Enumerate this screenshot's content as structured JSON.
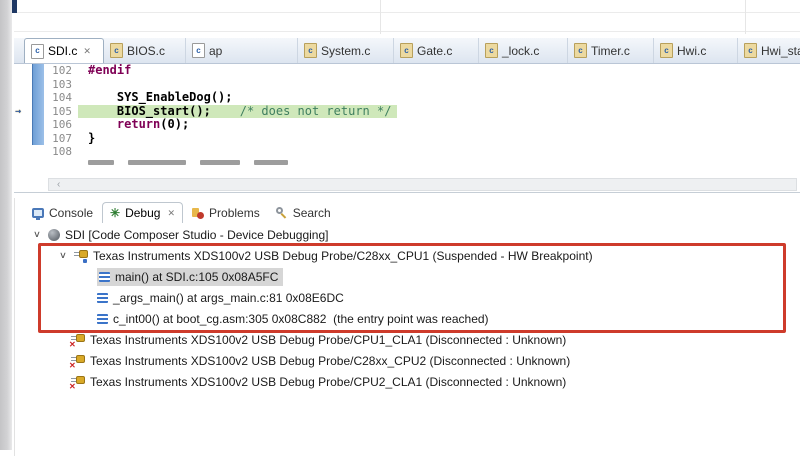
{
  "icons": {
    "close": "✕",
    "chevron_expanded": "∨",
    "scroll_left": "‹",
    "file_letter": "c",
    "pc_arrow": "→",
    "bug_glyph": "✳",
    "disconnected_x": "✕"
  },
  "colors": {
    "annotation_red": "#ce3b2b",
    "exec_line_green": "#cfe8ba",
    "keyword_purple": "#7f0055",
    "comment_green": "#3f7f5f",
    "selection_gray": "#d6d6d6",
    "range_bar_blue": "#6f9fd6"
  },
  "editor_tabs": {
    "tabs": [
      {
        "label": "SDI.c",
        "active": true
      },
      {
        "label": "BIOS.c"
      },
      {
        "label": "ap"
      },
      {
        "label": "System.c"
      },
      {
        "label": "Gate.c"
      },
      {
        "label": "_lock.c"
      },
      {
        "label": "Timer.c"
      },
      {
        "label": "Hwi.c"
      },
      {
        "label": "Hwi_sta"
      }
    ]
  },
  "editor": {
    "lines": {
      "l102": {
        "num": "102",
        "directive": "#endif"
      },
      "l103": {
        "num": "103"
      },
      "l104": {
        "num": "104",
        "code": "    SYS_EnableDog();"
      },
      "l105": {
        "num": "105",
        "code": "    BIOS_start();",
        "comment": "    /* does not return */"
      },
      "l106": {
        "num": "106",
        "indent": "    ",
        "keyword": "return",
        "rest": "(0);"
      },
      "l107": {
        "num": "107",
        "code": "}"
      },
      "l108": {
        "num": "108"
      }
    }
  },
  "debug_panel": {
    "tabs": [
      {
        "label": "Console"
      },
      {
        "label": "Debug",
        "active": true
      },
      {
        "label": "Problems"
      },
      {
        "label": "Search"
      }
    ],
    "tree": {
      "session": "SDI [Code Composer Studio - Device Debugging]",
      "cpu1": "Texas Instruments XDS100v2 USB Debug Probe/C28xx_CPU1 (Suspended - HW Breakpoint)",
      "frames": [
        "main() at SDI.c:105 0x08A5FC",
        "_args_main() at args_main.c:81 0x08E6DC",
        "c_int00() at boot_cg.asm:305 0x08C882  (the entry point was reached)"
      ],
      "disconnected": [
        "Texas Instruments XDS100v2 USB Debug Probe/CPU1_CLA1 (Disconnected : Unknown)",
        "Texas Instruments XDS100v2 USB Debug Probe/C28xx_CPU2 (Disconnected : Unknown)",
        "Texas Instruments XDS100v2 USB Debug Probe/CPU2_CLA1 (Disconnected : Unknown)"
      ]
    }
  }
}
